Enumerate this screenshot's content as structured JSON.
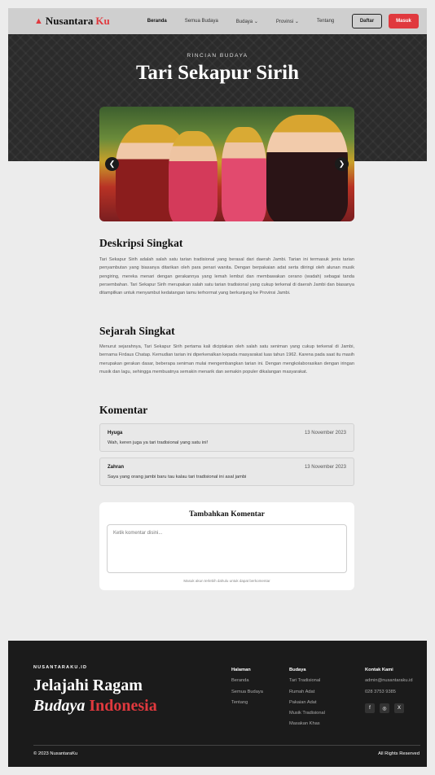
{
  "nav": {
    "logo_main": "Nusantara",
    "logo_accent": "Ku",
    "links": [
      "Beranda",
      "Semua Budaya",
      "Budaya",
      "Provinsi",
      "Tentang"
    ],
    "daftar": "Daftar",
    "masuk": "Masuk"
  },
  "hero": {
    "kicker": "RINCIAN BUDAYA",
    "title": "Tari Sekapur Sirih"
  },
  "desc": {
    "title": "Deskripsi Singkat",
    "text": "Tari Sekapur Sirih adalah salah satu tarian tradisional yang berasal dari daerah Jambi. Tarian ini termasuk jenis tarian penyambutan yang biasanya ditarikan oleh para penari wanita. Dengan berpakaian adat serta diiringi oleh alunan musik pengiring, mereka menari dengan gerakannya yang lemah lembut dan membawakan cerano (wadah) sebagai tanda persembahan. Tari Sekapur Sirih merupakan salah satu tarian tradisional yang cukup terkenal di daerah Jambi dan biasanya ditampilkan untuk menyambut kedatangan tamu terhormat yang berkunjung ke Provinsi Jambi."
  },
  "history": {
    "title": "Sejarah Singkat",
    "text": "Menurut sejarahnya, Tari Sekapur Sirih pertama kali diciptakan oleh salah satu seniman yang cukup terkenal di Jambi, bernama Firdaus Chatap. Kemudian tarian ini diperkenalkan kepada masyarakat luas tahun 1962. Karena pada saat itu masih merupakan gerakan dasar, beberapa seniman mulai mengembangkan tarian ini. Dengan mengkolaborasikan dengan iringan musik dan lagu, sehingga membuatnya semakin menarik dan semakin populer dikalangan masyarakat."
  },
  "comments": {
    "title": "Komentar",
    "items": [
      {
        "name": "Hyuga",
        "date": "13 November 2023",
        "text": "Wah, keren juga ya tari tradisional yang satu ini!"
      },
      {
        "name": "Zahran",
        "date": "13 November 2023",
        "text": "Saya yang orang jambi baru tau kalau tari tradisional ini asal jambi"
      }
    ]
  },
  "form": {
    "title": "Tambahkan Komentar",
    "placeholder": "Ketik komentar disini...",
    "hint": "Masuk akun terlebih dahulu untuk dapat berkomentar"
  },
  "footer": {
    "brand": "NUSANTARAKU.ID",
    "headline1": "Jelajahi Ragam",
    "headline2_white": "Budaya",
    "headline2_red": "Indonesia",
    "col_halaman": {
      "title": "Halaman",
      "items": [
        "Beranda",
        "Semua Budaya",
        "Tentang"
      ]
    },
    "col_budaya": {
      "title": "Budaya",
      "items": [
        "Tari Tradisional",
        "Rumah Adat",
        "Pakaian Adat",
        "Musik Tradisional",
        "Masakan Khas"
      ]
    },
    "col_kontak": {
      "title": "Kontak Kami",
      "email": "admin@nusantaraku.id",
      "phone": "028 3753 9385"
    },
    "socials": [
      "f",
      "◎",
      "X"
    ],
    "copyright": "© 2023 NusantaraKu",
    "rights": "All Rights Reserved"
  },
  "colors": {
    "accent": "#e0393e",
    "dark": "#1b1b1b",
    "hero": "#2b2b2b",
    "page": "#ececec"
  }
}
